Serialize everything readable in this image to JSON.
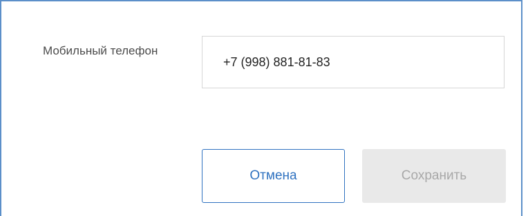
{
  "form": {
    "phone_label": "Мобильный телефон",
    "phone_value": "+7 (998) 881-81-83"
  },
  "actions": {
    "cancel_label": "Отмена",
    "save_label": "Сохранить",
    "save_disabled": true
  },
  "colors": {
    "panel_border": "#5b8fc9",
    "accent": "#2f72c0",
    "disabled_bg": "#e9e9e9",
    "disabled_text": "#a8a8a8"
  }
}
